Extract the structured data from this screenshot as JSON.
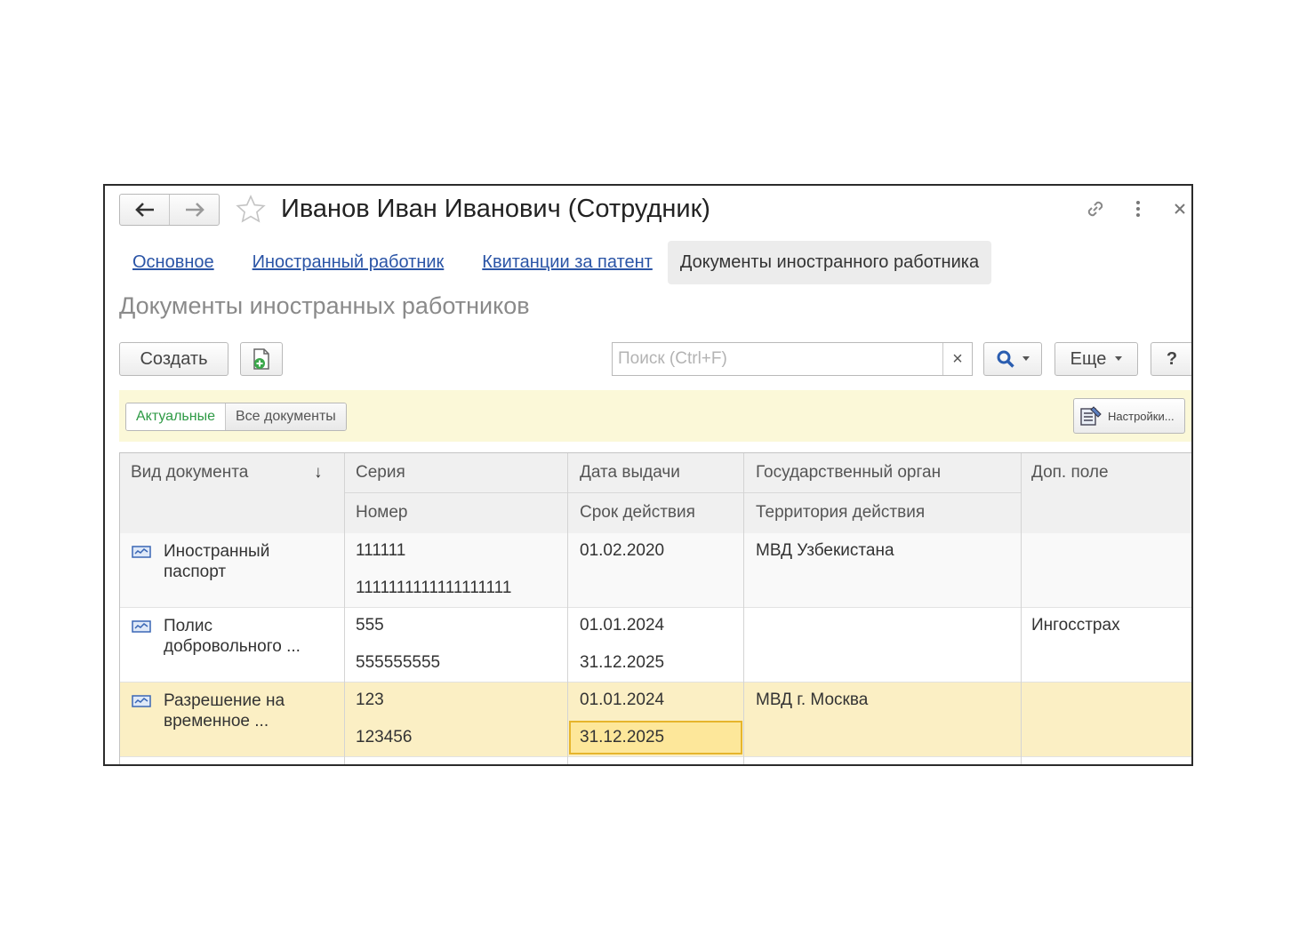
{
  "window": {
    "title": "Иванов Иван Иванович (Сотрудник)"
  },
  "tabs": [
    {
      "label": "Основное"
    },
    {
      "label": "Иностранный работник"
    },
    {
      "label": "Квитанции за патент"
    },
    {
      "label": "Документы иностранного работника"
    }
  ],
  "section": {
    "title": "Документы иностранных работников"
  },
  "toolbar": {
    "create_label": "Создать",
    "search_placeholder": "Поиск (Ctrl+F)",
    "clear_label": "×",
    "more_label": "Еще",
    "help_label": "?"
  },
  "filter": {
    "actual_label": "Актуальные",
    "all_label": "Все документы",
    "settings_label": "Настройки..."
  },
  "table": {
    "headers": {
      "doc_type": "Вид документа",
      "sort_indicator": "↓",
      "series": "Серия",
      "number": "Номер",
      "issue_date": "Дата выдачи",
      "valid_until": "Срок действия",
      "authority": "Государственный орган",
      "territory": "Территория действия",
      "extra": "Доп. поле"
    },
    "rows": [
      {
        "doc_type": "Иностранный паспорт",
        "series": "111111",
        "number": "1111111111111111111",
        "issue_date": "01.02.2020",
        "valid_until": "",
        "authority": "МВД Узбекистана",
        "territory": "",
        "extra": ""
      },
      {
        "doc_type": "Полис добровольного ...",
        "series": "555",
        "number": "555555555",
        "issue_date": "01.01.2024",
        "valid_until": "31.12.2025",
        "authority": "",
        "territory": "",
        "extra": "Ингосстрах"
      },
      {
        "doc_type": "Разрешение на временное ...",
        "series": "123",
        "number": "123456",
        "issue_date": "01.01.2024",
        "valid_until": "31.12.2025",
        "authority": "МВД г. Москва",
        "territory": "",
        "extra": ""
      }
    ]
  },
  "colors": {
    "link": "#2a54a6",
    "filter_bg": "#fbf8d8",
    "selected_row": "#fbefc4",
    "focused_cell": "#fde79a",
    "actual_green": "#2e9a45"
  }
}
